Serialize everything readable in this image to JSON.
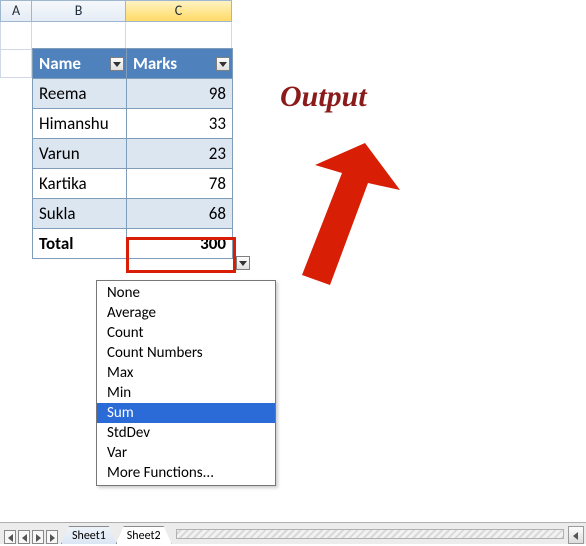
{
  "columns": {
    "a": "A",
    "b": "B",
    "c": "C"
  },
  "table": {
    "headers": {
      "name": "Name",
      "marks": "Marks"
    },
    "rows": [
      {
        "name": "Reema",
        "marks": "98"
      },
      {
        "name": "Himanshu",
        "marks": "33"
      },
      {
        "name": "Varun",
        "marks": "23"
      },
      {
        "name": "Kartika",
        "marks": "78"
      },
      {
        "name": "Sukla",
        "marks": "68"
      }
    ],
    "total": {
      "label": "Total",
      "value": "300"
    }
  },
  "func_menu": {
    "items": [
      "None",
      "Average",
      "Count",
      "Count Numbers",
      "Max",
      "Min",
      "Sum",
      "StdDev",
      "Var",
      "More Functions..."
    ],
    "selected": "Sum"
  },
  "annotation": {
    "output": "Output"
  },
  "sheets": {
    "tabs": [
      "Sheet1",
      "Sheet2"
    ],
    "active": "Sheet2"
  },
  "colors": {
    "accent": "#4f81bd",
    "highlight": "#d81e05",
    "selected_col": "#ffda66",
    "menu_sel": "#2a6bd8"
  }
}
